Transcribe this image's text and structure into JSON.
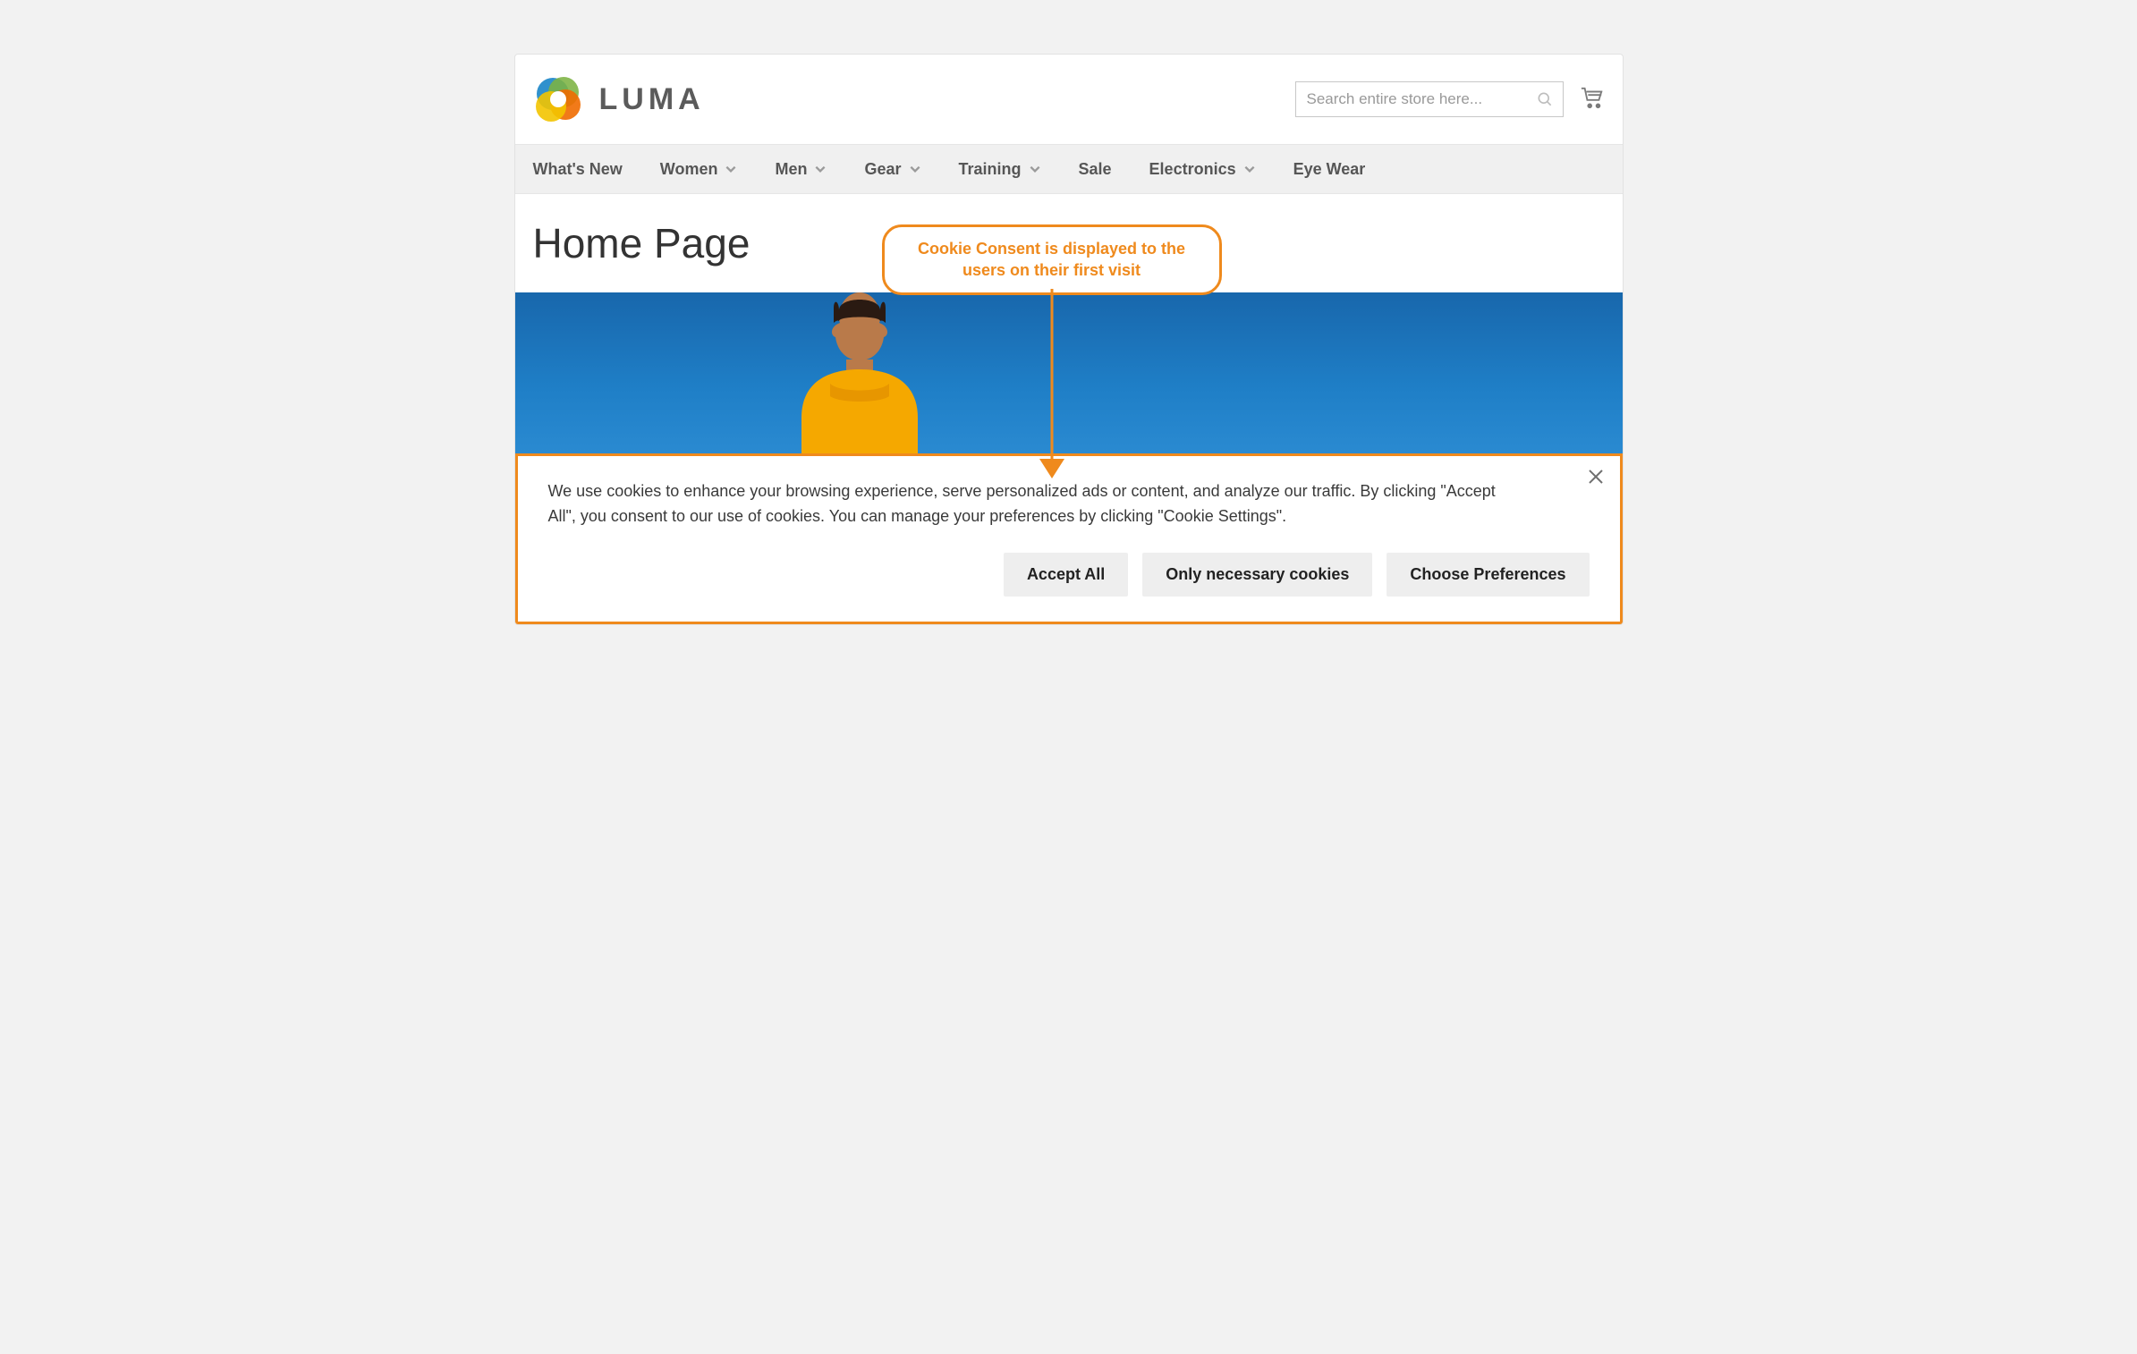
{
  "brand": {
    "name": "LUMA"
  },
  "search": {
    "placeholder": "Search entire store here..."
  },
  "nav": {
    "items": [
      {
        "label": "What's New",
        "has_submenu": false
      },
      {
        "label": "Women",
        "has_submenu": true
      },
      {
        "label": "Men",
        "has_submenu": true
      },
      {
        "label": "Gear",
        "has_submenu": true
      },
      {
        "label": "Training",
        "has_submenu": true
      },
      {
        "label": "Sale",
        "has_submenu": false
      },
      {
        "label": "Electronics",
        "has_submenu": true
      },
      {
        "label": "Eye Wear",
        "has_submenu": false
      }
    ]
  },
  "page": {
    "title": "Home Page"
  },
  "annotation": {
    "text": "Cookie Consent is displayed to the users on their first visit"
  },
  "cookie_banner": {
    "message": "We use cookies to enhance your browsing experience, serve personalized ads or content, and analyze our traffic. By clicking \"Accept All\", you consent to our use of cookies. You can manage your preferences by clicking \"Cookie Settings\".",
    "buttons": {
      "accept_all": "Accept All",
      "only_necessary": "Only necessary cookies",
      "choose_preferences": "Choose Preferences"
    }
  },
  "colors": {
    "accent_orange": "#ef8a1d",
    "nav_bg": "#f0f0f0",
    "hero_bg": "#1b73b8"
  }
}
